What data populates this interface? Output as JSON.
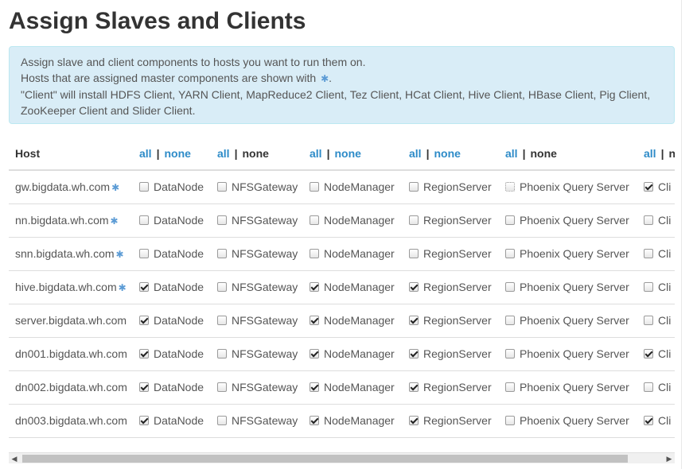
{
  "page": {
    "title": "Assign Slaves and Clients"
  },
  "info": {
    "line1": "Assign slave and client components to hosts you want to run them on.",
    "line2": "Hosts that are assigned master components are shown with",
    "line2_star": "✱",
    "line2_end": ".",
    "line3": "\"Client\" will install HDFS Client, YARN Client, MapReduce2 Client, Tez Client, HCat Client, Hive Client, HBase Client, Pig Client, ZooKeeper Client and Slider Client."
  },
  "table": {
    "host_header": "Host",
    "all_label": "all",
    "separator": "|",
    "none_label": "none",
    "columns": [
      {
        "name": "DataNode",
        "all_link": true,
        "none_link": true
      },
      {
        "name": "NFSGateway",
        "all_link": true,
        "none_link": false
      },
      {
        "name": "NodeManager",
        "all_link": true,
        "none_link": true
      },
      {
        "name": "RegionServer",
        "all_link": true,
        "none_link": true
      },
      {
        "name": "Phoenix Query Server",
        "all_link": true,
        "none_link": false
      },
      {
        "name": "Cli",
        "all_link": true,
        "none_link": false
      }
    ],
    "rows": [
      {
        "host": "gw.bigdata.wh.com",
        "master": true,
        "checks": [
          false,
          false,
          false,
          false,
          false,
          true
        ]
      },
      {
        "host": "nn.bigdata.wh.com",
        "master": true,
        "checks": [
          false,
          false,
          false,
          false,
          false,
          false
        ]
      },
      {
        "host": "snn.bigdata.wh.com",
        "master": true,
        "checks": [
          false,
          false,
          false,
          false,
          false,
          false
        ]
      },
      {
        "host": "hive.bigdata.wh.com",
        "master": true,
        "checks": [
          true,
          false,
          true,
          true,
          false,
          false
        ]
      },
      {
        "host": "server.bigdata.wh.com",
        "master": false,
        "checks": [
          true,
          false,
          true,
          true,
          false,
          false
        ]
      },
      {
        "host": "dn001.bigdata.wh.com",
        "master": false,
        "checks": [
          true,
          false,
          true,
          true,
          false,
          true
        ]
      },
      {
        "host": "dn002.bigdata.wh.com",
        "master": false,
        "checks": [
          true,
          false,
          true,
          true,
          false,
          false
        ]
      },
      {
        "host": "dn003.bigdata.wh.com",
        "master": false,
        "checks": [
          true,
          false,
          true,
          true,
          false,
          true
        ]
      }
    ]
  },
  "scrollbar": {
    "left_arrow": "◀",
    "right_arrow": "▶"
  }
}
